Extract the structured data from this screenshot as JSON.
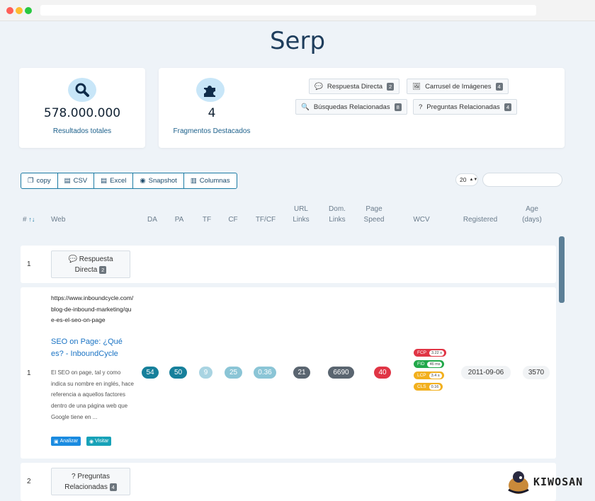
{
  "page": {
    "title": "Serp"
  },
  "summary": {
    "total_results": {
      "value": "578.000.000",
      "label": "Resultados totales",
      "icon": "search-icon"
    },
    "featured": {
      "value": "4",
      "label": "Fragmentos Destacados",
      "icon": "puzzle-icon"
    },
    "snippets": [
      {
        "label": "Respuesta Directa",
        "count": "2",
        "icon": "speech-bubble-icon"
      },
      {
        "label": "Carrusel de Imágenes",
        "count": "4",
        "icon": "images-icon"
      },
      {
        "label": "Búsquedas Relacionadas",
        "count": "8",
        "icon": "search-icon"
      },
      {
        "label": "Preguntas Relacionadas",
        "count": "4",
        "icon": "question-circle-icon"
      }
    ]
  },
  "toolbar": {
    "buttons": [
      {
        "label": "copy",
        "icon": "copy-icon"
      },
      {
        "label": "CSV",
        "icon": "file-csv-icon"
      },
      {
        "label": "Excel",
        "icon": "file-excel-icon"
      },
      {
        "label": "Snapshot",
        "icon": "eye-icon"
      },
      {
        "label": "Columnas",
        "icon": "columns-icon"
      }
    ],
    "page_size": "20",
    "search_placeholder": ""
  },
  "table": {
    "headers": {
      "num": "#",
      "web": "Web",
      "da": "DA",
      "pa": "PA",
      "tf": "TF",
      "cf": "CF",
      "tfcf": "TF/CF",
      "url_links_1": "URL",
      "url_links_2": "Links",
      "dom_links_1": "Dom.",
      "dom_links_2": "Links",
      "page_speed_1": "Page",
      "page_speed_2": "Speed",
      "wcv": "WCV",
      "registered": "Registered",
      "age_1": "Age",
      "age_2": "(days)"
    },
    "group_row_1": {
      "num": "1",
      "label_1": "Respuesta",
      "label_2": "Directa",
      "count": "2",
      "icon": "speech-bubble-icon"
    },
    "result_row": {
      "num": "1",
      "url": "https://www.inboundcycle.com/blog-de-inbound-marketing/que-es-el-seo-on-page",
      "title": "SEO on Page: ¿Qué es? - InboundCycle",
      "description": "El SEO on page, tal y como indica su nombre en inglés, hace referencia a aquellos factores dentro de una página web que Google tiene en ...",
      "analyze_label": "Analizar",
      "visit_label": "Visitar",
      "da": "54",
      "pa": "50",
      "tf": "9",
      "cf": "25",
      "tfcf": "0.36",
      "url_links": "21",
      "dom_links": "6690",
      "page_speed": "40",
      "wcv": {
        "fcp_label": "FCP",
        "fcp_value": "3.22 s",
        "fid_label": "FID",
        "fid_value": "46 ms",
        "lcp_label": "LCP",
        "lcp_value": "3.4 s",
        "cls_label": "CLS",
        "cls_value": "0.16"
      },
      "registered": "2011-09-06",
      "age": "3570"
    },
    "group_row_2": {
      "num": "2",
      "label_1": "Preguntas",
      "label_2": "Relacionadas",
      "count": "4",
      "icon": "question-circle-icon"
    }
  },
  "brand": {
    "name": "KIWOSAN"
  },
  "colors": {
    "title": "#1e3d5c",
    "accent": "#1b7aa3",
    "teal": "#17809b",
    "light_teal": "#8bc5d6",
    "gray": "#5a6570",
    "red": "#e03545",
    "green": "#22a84a",
    "orange": "#f2b01e",
    "link": "#1a73c4"
  }
}
